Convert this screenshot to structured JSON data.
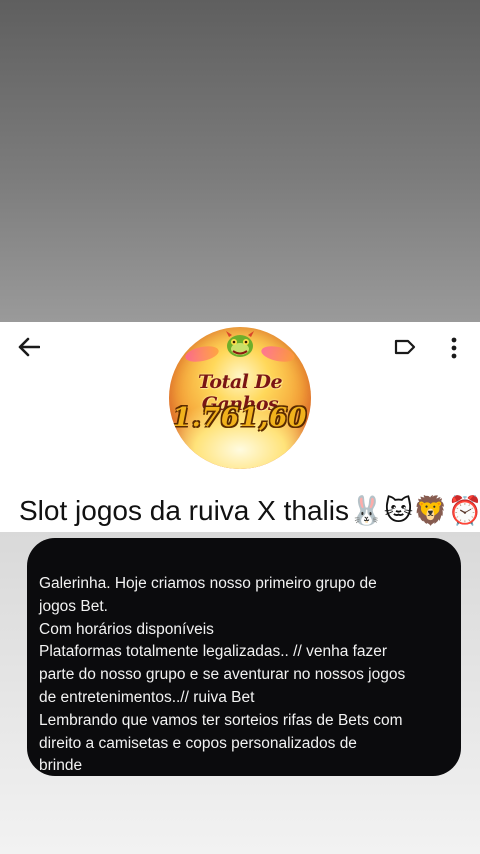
{
  "header": {
    "avatar": {
      "title": "Total De Ganhos",
      "amount": "1.761,60"
    },
    "group_name": "Slot jogos da ruiva X thalis🐰🐱🦁⏰"
  },
  "icons": {
    "back": "arrow-left-icon",
    "label": "label-tag-icon",
    "more": "more-vertical-icon"
  },
  "description": {
    "lines": [
      "Galerinha. Hoje criamos nosso primeiro grupo de",
      "jogos Bet.",
      "Com horários disponíveis",
      "Plataformas totalmente legalizadas..  // venha fazer",
      "parte do nosso grupo e se aventurar no nossos jogos",
      "de entretenimentos..// ruiva Bet",
      "Lembrando que vamos ter sorteios rifas de Bets com",
      "direito a camisetas e copos personalizados  de",
      "brinde"
    ]
  },
  "colors": {
    "card_background": "#0b0b0d",
    "card_text": "#f2f2f2",
    "header_background": "#ffffff"
  }
}
